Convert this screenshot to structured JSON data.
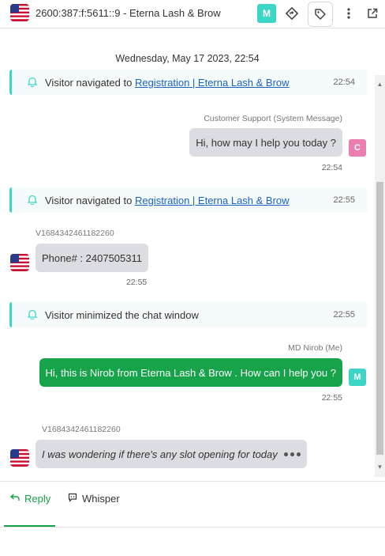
{
  "header": {
    "title": "2600:387:f:5611::9 - Eterna Lash & Brow",
    "agent_initial": "M",
    "flag_icon": "us-flag-icon",
    "icons": [
      "route-icon",
      "tag-icon",
      "more-vertical-icon",
      "external-link-icon"
    ]
  },
  "chat": {
    "date": "Wednesday, May 17 2023, 22:54",
    "events": {
      "nav1": {
        "text": "Visitor navigated to ",
        "link": "Registration | Eterna Lash & Brow",
        "time": "22:54"
      },
      "nav2": {
        "text": "Visitor navigated to ",
        "link": "Registration | Eterna Lash & Brow",
        "time": "22:55"
      },
      "minimized": {
        "text": "Visitor minimized the chat window",
        "time": "22:55"
      }
    },
    "messages": {
      "support": {
        "sender": "Customer Support (System Message)",
        "text": "Hi, how may I help you today ?",
        "time": "22:54",
        "avatar": "C"
      },
      "visitor1": {
        "sender": "V1684342461182260",
        "text": "Phone# : 2407505311",
        "time": "22:55"
      },
      "agent": {
        "sender": "MD Nirob (Me)",
        "text": "Hi, this is Nirob from Eterna Lash & Brow . How can I help you ?",
        "time": "22:55",
        "avatar": "M"
      },
      "visitor2": {
        "sender": "V1684342461182260",
        "text": "I was wondering if there's any slot opening for today"
      }
    }
  },
  "footer": {
    "tabs": [
      {
        "label": "Reply",
        "active": true
      },
      {
        "label": "Whisper",
        "active": false
      }
    ]
  },
  "colors": {
    "accent_teal": "#3dd6c6",
    "agent_green": "#16a34a",
    "support_pink": "#ec7fb0",
    "link_blue": "#1a63c2"
  }
}
